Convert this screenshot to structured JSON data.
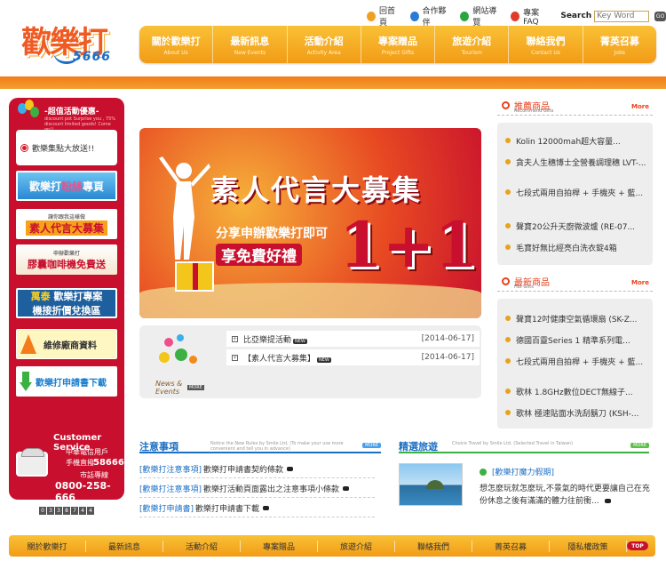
{
  "logo": {
    "main": "歡樂打",
    "number": "5666"
  },
  "toplinks": [
    {
      "label": "回首頁",
      "icon": "home-icon"
    },
    {
      "label": "合作夥伴",
      "icon": "partner-icon"
    },
    {
      "label": "網站導覽",
      "icon": "sitemap-icon"
    },
    {
      "label": "專案FAQ",
      "icon": "faq-icon"
    }
  ],
  "search": {
    "label": "Search",
    "placeholder": "Key Word",
    "go": "GO"
  },
  "nav": [
    {
      "zh": "關於歡樂打",
      "en": "About Us"
    },
    {
      "zh": "最新訊息",
      "en": "New Events"
    },
    {
      "zh": "活動介紹",
      "en": "Activity Area"
    },
    {
      "zh": "專案贈品",
      "en": "Project Gifts"
    },
    {
      "zh": "旅遊介紹",
      "en": "Tourism"
    },
    {
      "zh": "聯絡我們",
      "en": "Contact Us"
    },
    {
      "zh": "菁英召募",
      "en": "Jobs"
    }
  ],
  "sidebar": {
    "title": "-超值活動優惠-",
    "subtitle": "discount pot Surprise you , 75% discount limited goods! Come on!!",
    "promo": "歡樂集點大放送!!",
    "banner1_a": "歡樂打",
    "banner1_b": "粉絲",
    "banner1_c": "專頁",
    "banner2_small": "讓你跟我這樣做",
    "banner2_big": "素人代言大募集",
    "banner3_small": "申辦歡樂打",
    "banner3_big": "膠囊咖啡機免費送",
    "banner4_a": "萬泰",
    "banner4_b": "歡樂打專案",
    "banner4_c": "機接折價兌換區",
    "banner5": "維修廠商資料",
    "banner6": "歡樂打申請書下載",
    "cs_title": "Customer Service",
    "cs_line1": "中華電信用戶",
    "cs_line2": "手機直撥",
    "cs_line3": "58666",
    "cs_line4": "市話專線",
    "cs_line5": "0800-258-666",
    "counter": [
      "0",
      "3",
      "3",
      "8",
      "7",
      "4",
      "4"
    ]
  },
  "hero": {
    "title": "素人代言大募集",
    "sub1": "分享申辦歡樂打即可",
    "sub2": "享免費好禮",
    "big": "1+1"
  },
  "news": {
    "logo_text": "News & Events",
    "more": "MORE",
    "items": [
      {
        "text": "比亞樂提活動",
        "badge": "NEW",
        "date": "[2014-06-17]"
      },
      {
        "text": "【素人代言大募集】",
        "badge": "NEW",
        "date": "[2014-06-17]"
      }
    ]
  },
  "recommend": {
    "title": "推薦商品",
    "en": "Recommend Gifts",
    "more": "More",
    "items": [
      "Kolin 12000mah超大容量...",
      "貪夫人生穗博士全營養調理穗 LVT-...",
      "七段式兩用自拍桿 + 手機夾 + 藍...",
      "聲寶20公升天廚微波爐 (RE-07...",
      "毛寶好無比經亮白洗衣錠4箱"
    ]
  },
  "latest": {
    "title": "最新商品",
    "en": "Hot Gifts",
    "more": "More",
    "items": [
      "聲寶12吋健康空氣循環扇 (SK-Z...",
      "德國百靈Series 1 精準系列電...",
      "七段式兩用自拍桿 + 手機夾 + 藍...",
      "歌林 1.8GHz數位DECT無線子...",
      "歌林 極速貼面水洗刮鬍刀 (KSH-..."
    ]
  },
  "notice": {
    "title": "注意事項",
    "en": "Notice the New Rules by Smile Ltd. (To make your use more convenient and tell you in advance)",
    "more": "MORE",
    "items": [
      {
        "cat": "[歡樂打注意事項]",
        "text": "歡樂打申請書契約條款"
      },
      {
        "cat": "[歡樂打注意事項]",
        "text": "歡樂打活動頁面露出之注意事項小條款"
      },
      {
        "cat": "[歡樂打申請書]",
        "text": "歡樂打申請書下載"
      }
    ]
  },
  "travel": {
    "title": "精選旅遊",
    "en": "Choice Travel by Smile Ltd. (Selected Travel in Taiwan)",
    "more": "MORE",
    "item_title": "[歡樂打魔力假期]",
    "item_desc": "想怎麼玩就怎麼玩,不景氣的時代更要讓自己在充份休息之後有滿滿的體力往前衝..."
  },
  "footer": [
    "關於歡樂打",
    "最新訊息",
    "活動介紹",
    "專案贈品",
    "旅遊介紹",
    "聯絡我們",
    "菁英召募",
    "隱私權政策"
  ],
  "top_label": "TOP",
  "colors": {
    "accent": "#f29b16",
    "brand_red": "#c8102e",
    "link_blue": "#1b6fc4"
  }
}
